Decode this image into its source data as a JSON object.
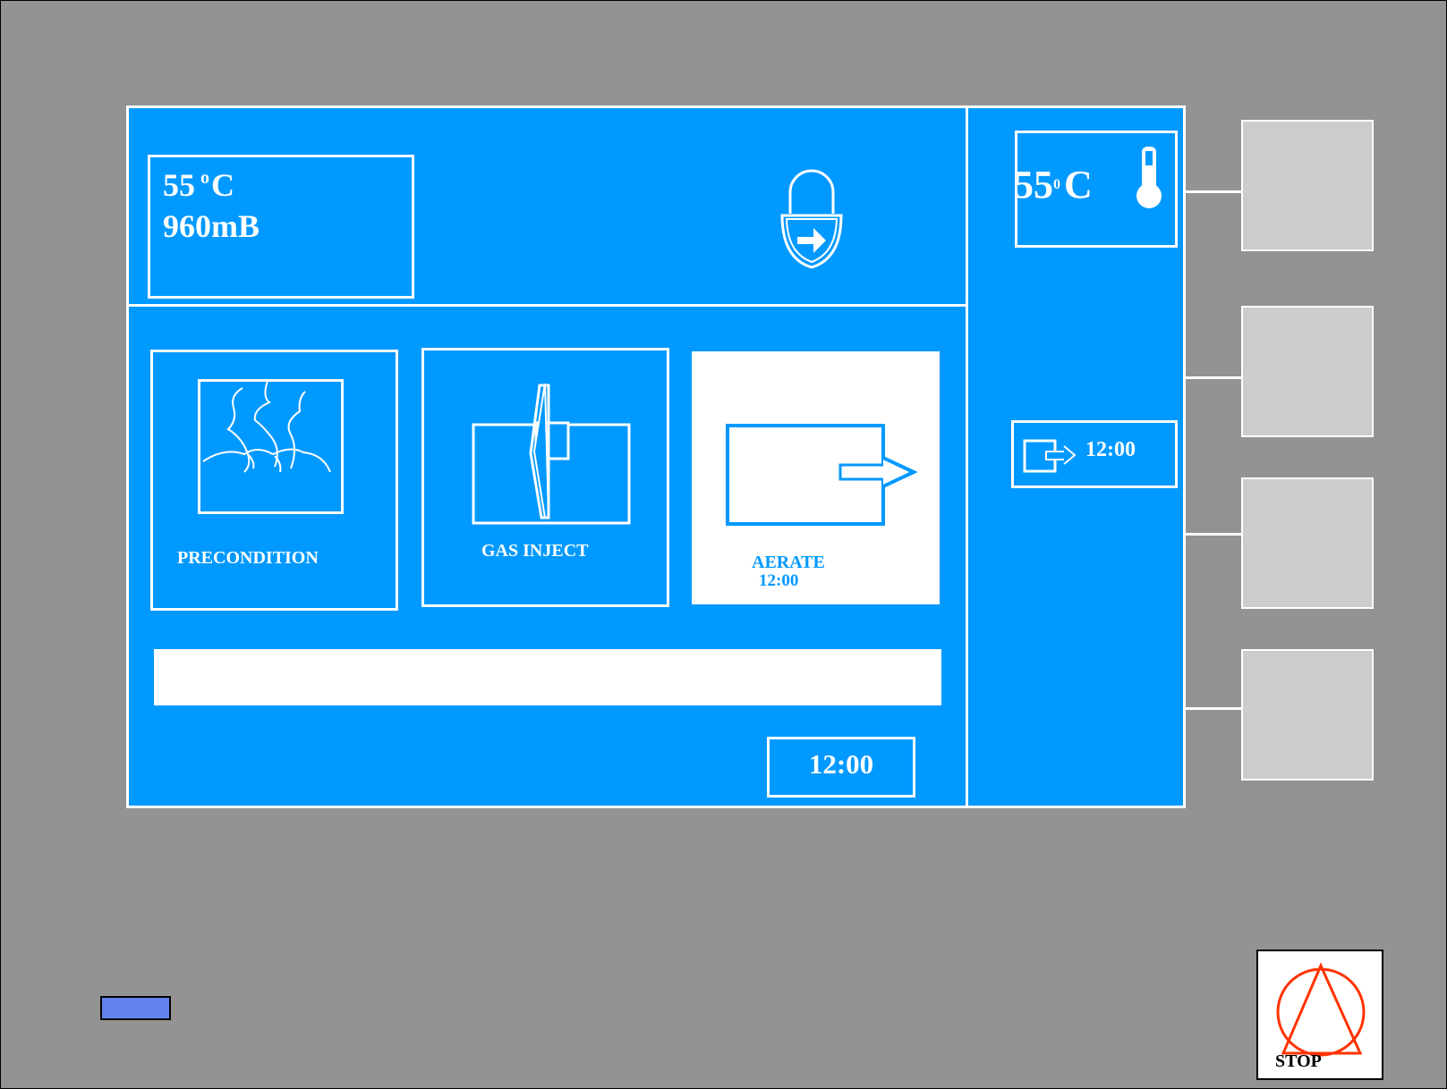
{
  "status_panel": {
    "temperature_value": "55",
    "temperature_degree": "o",
    "temperature_unit": "C",
    "pressure": "960mB"
  },
  "stages": [
    {
      "label": "PRECONDITION",
      "icon": "humidity-icon",
      "active": false
    },
    {
      "label": "GAS INJECT",
      "icon": "gas-inject-icon",
      "active": false
    },
    {
      "label": "AERATE",
      "time": "12:00",
      "icon": "aerate-exit-icon",
      "active": true
    }
  ],
  "progress": {
    "fraction": 0.0
  },
  "cycle_clock": "12:00",
  "side_panel": {
    "temperature_value": "55",
    "temperature_degree": "0",
    "temperature_unit": "C",
    "remaining_time": "12:00"
  },
  "stop_button": {
    "label": "STOP"
  },
  "colors": {
    "screen_background": "#0099ff",
    "bezel": "#939393",
    "soft_key": "#cccccc",
    "led": "#6382ee",
    "stop_accent": "#ff3300"
  }
}
